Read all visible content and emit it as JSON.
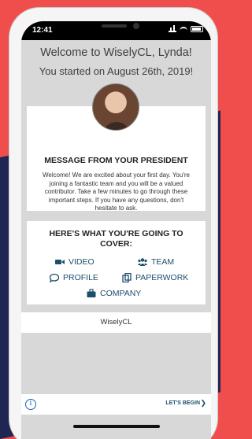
{
  "status": {
    "time": "12:41"
  },
  "header": {
    "title": "Welcome to WiselyCL, Lynda!",
    "started": "You started on August 26th, 2019!"
  },
  "message": {
    "heading": "MESSAGE FROM YOUR PRESIDENT",
    "body": "Welcome! We are excited about your first day. You're joining a fantastic team and you will be a valued contributor. Take a few minutes to go through these important steps. If you have any questions, don't hesitate to ask."
  },
  "cover": {
    "heading": "HERE'S WHAT YOU'RE GOING TO COVER:",
    "items": [
      {
        "label": "VIDEO",
        "icon": "video-camera-icon"
      },
      {
        "label": "TEAM",
        "icon": "team-icon"
      },
      {
        "label": "PROFILE",
        "icon": "chat-bubble-icon"
      },
      {
        "label": "PAPERWORK",
        "icon": "documents-icon"
      },
      {
        "label": "COMPANY",
        "icon": "briefcase-icon"
      }
    ]
  },
  "brand": "WiselyCL",
  "bottom": {
    "begin_label": "LET'S BEGIN"
  },
  "colors": {
    "accent": "#1d4e6a",
    "background_red": "#f04e4c",
    "background_navy": "#1f2652",
    "info_blue": "#1a63c8"
  }
}
